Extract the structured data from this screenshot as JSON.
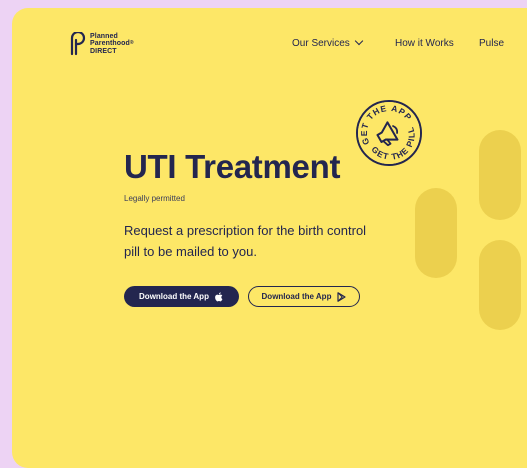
{
  "brand": {
    "name_line1": "Planned",
    "name_line2": "Parenthood",
    "name_line3": "DIRECT",
    "mark": "®"
  },
  "nav": {
    "services": "Our Services",
    "how_it_works": "How it Works",
    "pulse": "Pulse"
  },
  "badge": {
    "top_text": "GET THE APP",
    "bottom_text": "GET THE PILL",
    "icon": "megaphone-icon"
  },
  "hero": {
    "title": "UTI Treatment",
    "legal": "Legally permitted",
    "description": "Request a prescription for the birth control pill to be mailed to you."
  },
  "buttons": {
    "apple_label": "Download the App",
    "apple_icon": "apple-icon",
    "play_label": "Download the App",
    "play_icon": "play-store-icon"
  },
  "colors": {
    "page_bg": "#EDD3F4",
    "card_bg": "#FDE767",
    "navy": "#23264F",
    "pill_shape": "#ECD04E"
  }
}
